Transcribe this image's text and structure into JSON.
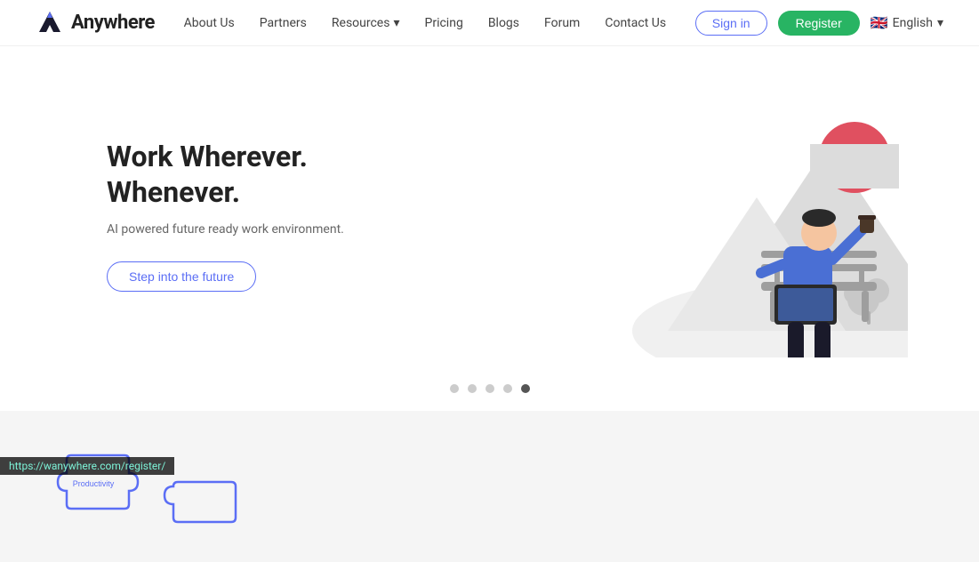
{
  "brand": {
    "name": "Anywhere",
    "logo_alt": "Anywhere logo"
  },
  "navbar": {
    "links": [
      {
        "label": "About Us",
        "has_dropdown": false
      },
      {
        "label": "Partners",
        "has_dropdown": false
      },
      {
        "label": "Resources",
        "has_dropdown": true
      },
      {
        "label": "Pricing",
        "has_dropdown": false
      },
      {
        "label": "Blogs",
        "has_dropdown": false
      },
      {
        "label": "Forum",
        "has_dropdown": false
      },
      {
        "label": "Contact Us",
        "has_dropdown": false
      }
    ],
    "signin_label": "Sign in",
    "register_label": "Register",
    "language": {
      "flag": "🇬🇧",
      "label": "English",
      "chevron": "▾"
    }
  },
  "hero": {
    "title": "Work Wherever. Whenever.",
    "subtitle": "AI powered future ready work environment.",
    "cta_label": "Step into the future"
  },
  "carousel": {
    "dots": [
      {
        "active": false
      },
      {
        "active": false
      },
      {
        "active": false
      },
      {
        "active": false
      },
      {
        "active": true
      }
    ]
  },
  "bottom": {
    "puzzle_label": "Productivity"
  },
  "statusbar": {
    "url": "https://wanywhere.com/register/"
  },
  "colors": {
    "accent": "#5b6ef5",
    "register_green": "#28b463",
    "text_dark": "#222222",
    "text_mid": "#444444",
    "text_light": "#666666"
  }
}
